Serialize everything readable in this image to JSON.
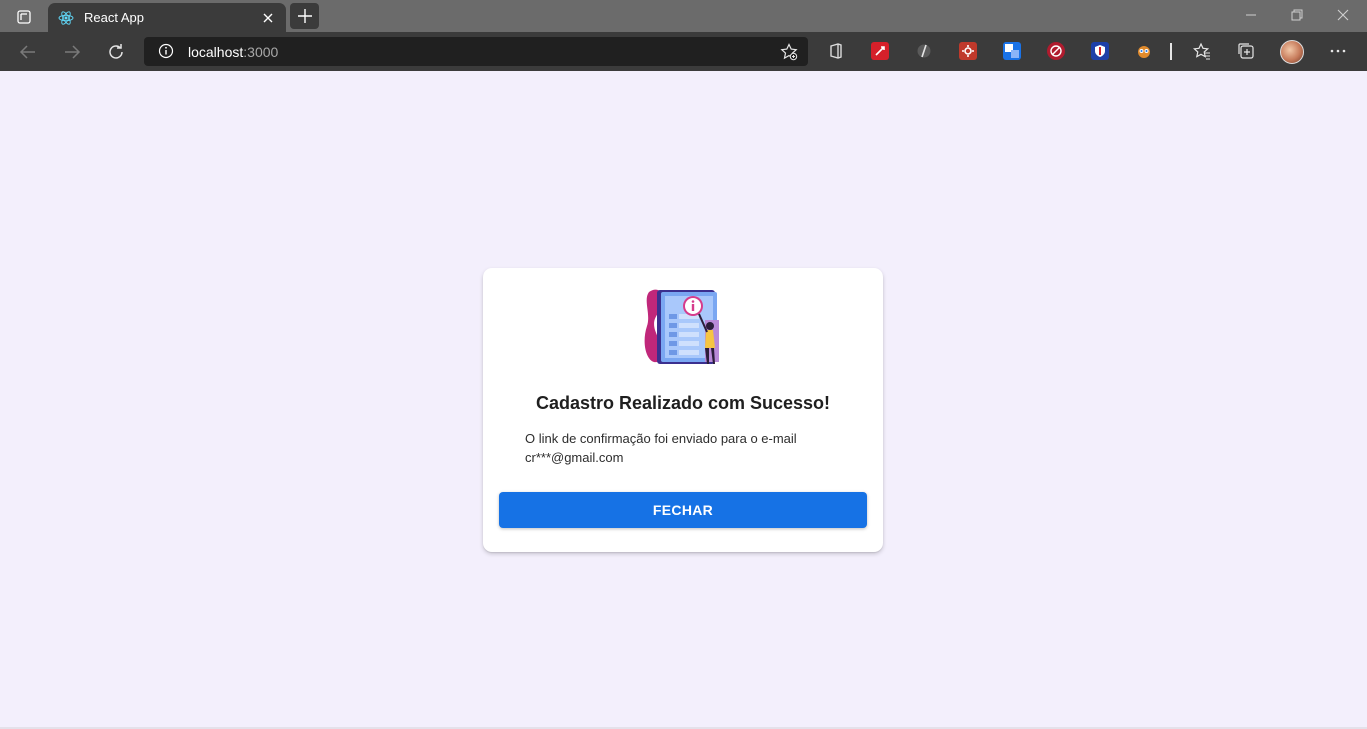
{
  "browser": {
    "tab": {
      "title": "React App"
    },
    "address": {
      "host": "localhost",
      "port": ":3000"
    }
  },
  "dialog": {
    "title": "Cadastro Realizado com Sucesso!",
    "message_line1": "O link de confirmação foi enviado para o e-mail",
    "message_line2": "cr***@gmail.com",
    "button_label": "FECHAR"
  },
  "colors": {
    "page_background": "#f3effc",
    "primary_button": "#1672e5",
    "browser_tabstrip": "#6b6b6b",
    "browser_toolbar": "#3b3b3b"
  }
}
